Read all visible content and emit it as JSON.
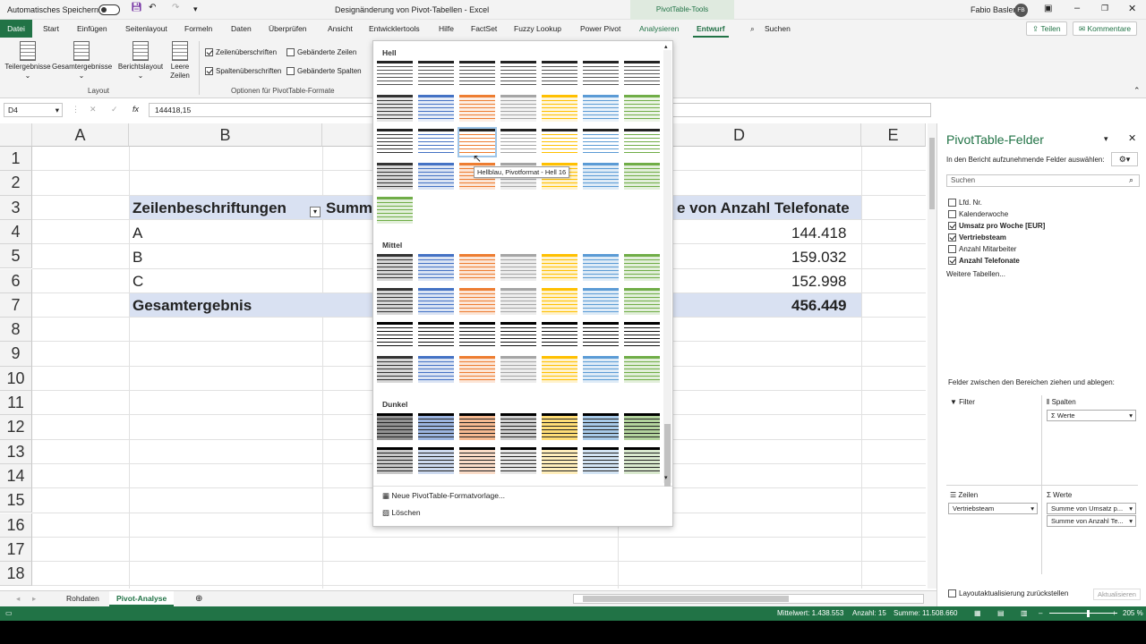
{
  "titlebar": {
    "autosave_label": "Automatisches Speichern",
    "doc_title": "Designänderung von Pivot-Tabellen  -  Excel",
    "context_tab_group": "PivotTable-Tools",
    "user_name": "Fabio Basler",
    "avatar_initials": "FB"
  },
  "ribbon_tabs": [
    "Datei",
    "Start",
    "Einfügen",
    "Seitenlayout",
    "Formeln",
    "Daten",
    "Überprüfen",
    "Ansicht",
    "Entwicklertools",
    "Hilfe",
    "FactSet",
    "Fuzzy Lookup",
    "Power Pivot",
    "Analysieren",
    "Entwurf"
  ],
  "search_label": "Suchen",
  "share_label": "Teilen",
  "comments_label": "Kommentare",
  "ribbon": {
    "layout_buttons": [
      "Teilergebnisse",
      "Gesamtergebnisse",
      "Berichtslayout",
      "Leere Zeilen"
    ],
    "layout_group": "Layout",
    "options": [
      {
        "label": "Zeilenüberschriften",
        "checked": true
      },
      {
        "label": "Gebänderte Zeilen",
        "checked": false
      },
      {
        "label": "Spaltenüberschriften",
        "checked": true
      },
      {
        "label": "Gebänderte Spalten",
        "checked": false
      }
    ],
    "options_group": "Optionen für PivotTable-Formate"
  },
  "formula": {
    "namebox": "D4",
    "value": "144418,15",
    "fx": "fx"
  },
  "sheet": {
    "columns": [
      "A",
      "B",
      "D",
      "E"
    ],
    "rows": [
      "1",
      "2",
      "3",
      "4",
      "5",
      "6",
      "7",
      "8",
      "9",
      "10",
      "11",
      "12",
      "13",
      "14",
      "15",
      "16",
      "17",
      "18"
    ],
    "header_row_label": "Zeilenbeschriftungen",
    "header_summe_partial": "Summ",
    "header_d_partial": "e von Anzahl Telefonate",
    "data": [
      {
        "label": "A",
        "value": "144.418"
      },
      {
        "label": "B",
        "value": "159.032"
      },
      {
        "label": "C",
        "value": "152.998"
      }
    ],
    "total_label": "Gesamtergebnis",
    "total_value": "456.449"
  },
  "gallery": {
    "sections": [
      "Hell",
      "Mittel",
      "Dunkel"
    ],
    "tooltip": "Hellblau, Pivotformat - Hell 16",
    "new_style": "Neue PivotTable-Formatvorlage...",
    "clear": "Löschen",
    "colors": [
      "#333333",
      "#4472c4",
      "#ed7d31",
      "#a5a5a5",
      "#ffc000",
      "#5b9bd5",
      "#70ad47"
    ]
  },
  "sheet_tabs": [
    "Rohdaten",
    "Pivot-Analyse"
  ],
  "status": {
    "average": "Mittelwert: 1.438.553",
    "count": "Anzahl: 15",
    "sum": "Summe: 11.508.660",
    "zoom": "205 %"
  },
  "pane": {
    "title": "PivotTable-Felder",
    "subtitle": "In den Bericht aufzunehmende Felder auswählen:",
    "search_placeholder": "Suchen",
    "fields": [
      {
        "label": "Lfd. Nr.",
        "checked": false,
        "bold": false
      },
      {
        "label": "Kalenderwoche",
        "checked": false,
        "bold": false
      },
      {
        "label": "Umsatz pro Woche [EUR]",
        "checked": true,
        "bold": true
      },
      {
        "label": "Vertriebsteam",
        "checked": true,
        "bold": true
      },
      {
        "label": "Anzahl Mitarbeiter",
        "checked": false,
        "bold": false
      },
      {
        "label": "Anzahl Telefonate",
        "checked": true,
        "bold": true
      }
    ],
    "more_tables": "Weitere Tabellen...",
    "drag_hint": "Felder zwischen den Bereichen ziehen und ablegen:",
    "filter_label": "Filter",
    "columns_label": "Spalten",
    "columns_item": "Werte",
    "rows_label": "Zeilen",
    "rows_item": "Vertriebsteam",
    "values_label": "Werte",
    "values_items": [
      "Summe von Umsatz p...",
      "Summe von Anzahl Te..."
    ],
    "defer_label": "Layoutaktualisierung zurückstellen",
    "update_label": "Aktualisieren"
  }
}
